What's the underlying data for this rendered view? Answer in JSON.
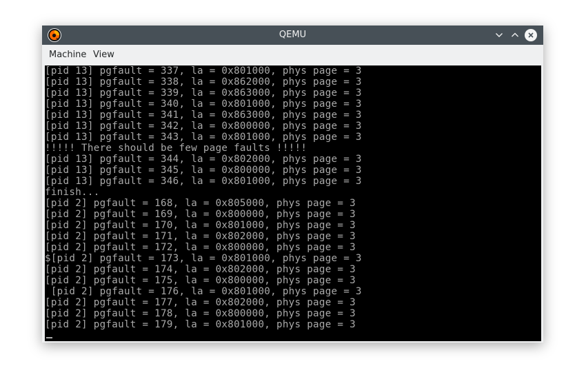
{
  "window": {
    "title": "QEMU",
    "icon": "qemu-logo-icon"
  },
  "titlebar_buttons": {
    "minimize_icon": "chevron-down-icon",
    "maximize_icon": "chevron-up-icon",
    "close_icon": "close-icon"
  },
  "menu": {
    "machine": "Machine",
    "view": "View"
  },
  "console": {
    "lines": [
      "[pid 13] pgfault = 337, la = 0x801000, phys page = 3",
      "[pid 13] pgfault = 338, la = 0x862000, phys page = 3",
      "[pid 13] pgfault = 339, la = 0x863000, phys page = 3",
      "[pid 13] pgfault = 340, la = 0x801000, phys page = 3",
      "[pid 13] pgfault = 341, la = 0x863000, phys page = 3",
      "[pid 13] pgfault = 342, la = 0x800000, phys page = 3",
      "[pid 13] pgfault = 343, la = 0x801000, phys page = 3",
      "!!!!! There should be few page faults !!!!!",
      "[pid 13] pgfault = 344, la = 0x802000, phys page = 3",
      "[pid 13] pgfault = 345, la = 0x800000, phys page = 3",
      "[pid 13] pgfault = 346, la = 0x801000, phys page = 3",
      "finish...",
      "[pid 2] pgfault = 168, la = 0x805000, phys page = 3",
      "[pid 2] pgfault = 169, la = 0x800000, phys page = 3",
      "[pid 2] pgfault = 170, la = 0x801000, phys page = 3",
      "[pid 2] pgfault = 171, la = 0x802000, phys page = 3",
      "[pid 2] pgfault = 172, la = 0x800000, phys page = 3",
      "$[pid 2] pgfault = 173, la = 0x801000, phys page = 3",
      "[pid 2] pgfault = 174, la = 0x802000, phys page = 3",
      "[pid 2] pgfault = 175, la = 0x800000, phys page = 3",
      " [pid 2] pgfault = 176, la = 0x801000, phys page = 3",
      "[pid 2] pgfault = 177, la = 0x802000, phys page = 3",
      "[pid 2] pgfault = 178, la = 0x800000, phys page = 3",
      "[pid 2] pgfault = 179, la = 0x801000, phys page = 3"
    ]
  },
  "colors": {
    "titlebar": "#475057",
    "console_bg": "#000000",
    "console_text": "#aaaaaa"
  }
}
